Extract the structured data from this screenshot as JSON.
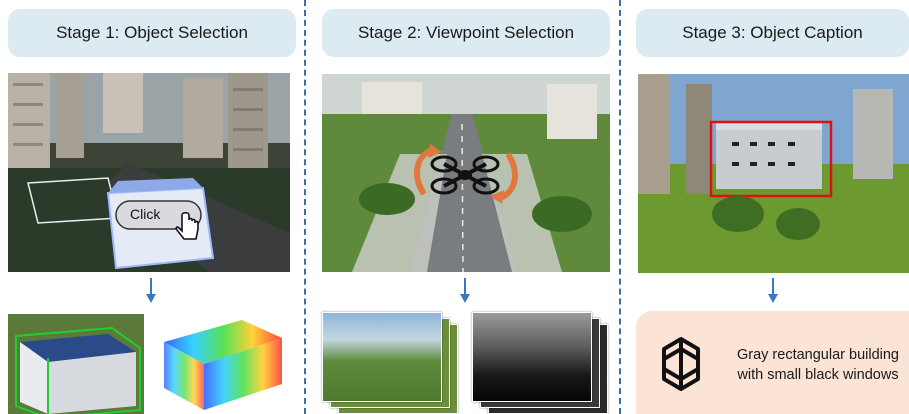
{
  "stages": [
    {
      "title": "Stage 1: Object Selection"
    },
    {
      "title": "Stage 2: Viewpoint Selection"
    },
    {
      "title": "Stage 3: Object Caption"
    }
  ],
  "stage1": {
    "click_label": "Click"
  },
  "stage3": {
    "caption_text": "Gray rectangular building with small black windows"
  },
  "icons": {
    "cursor": "hand-pointer-icon",
    "drone": "quadcopter-drone-icon",
    "rotation": "curved-rotation-arrow-icon",
    "caption_model": "openai-logo-icon"
  },
  "colors": {
    "title_bg": "#dcebf1",
    "divider": "#3a6fa8",
    "flow_arrow": "#3a78c2",
    "highlight_box": "#e01010",
    "bbox_green": "#22cc33",
    "caption_bg": "#fbe4d6"
  }
}
